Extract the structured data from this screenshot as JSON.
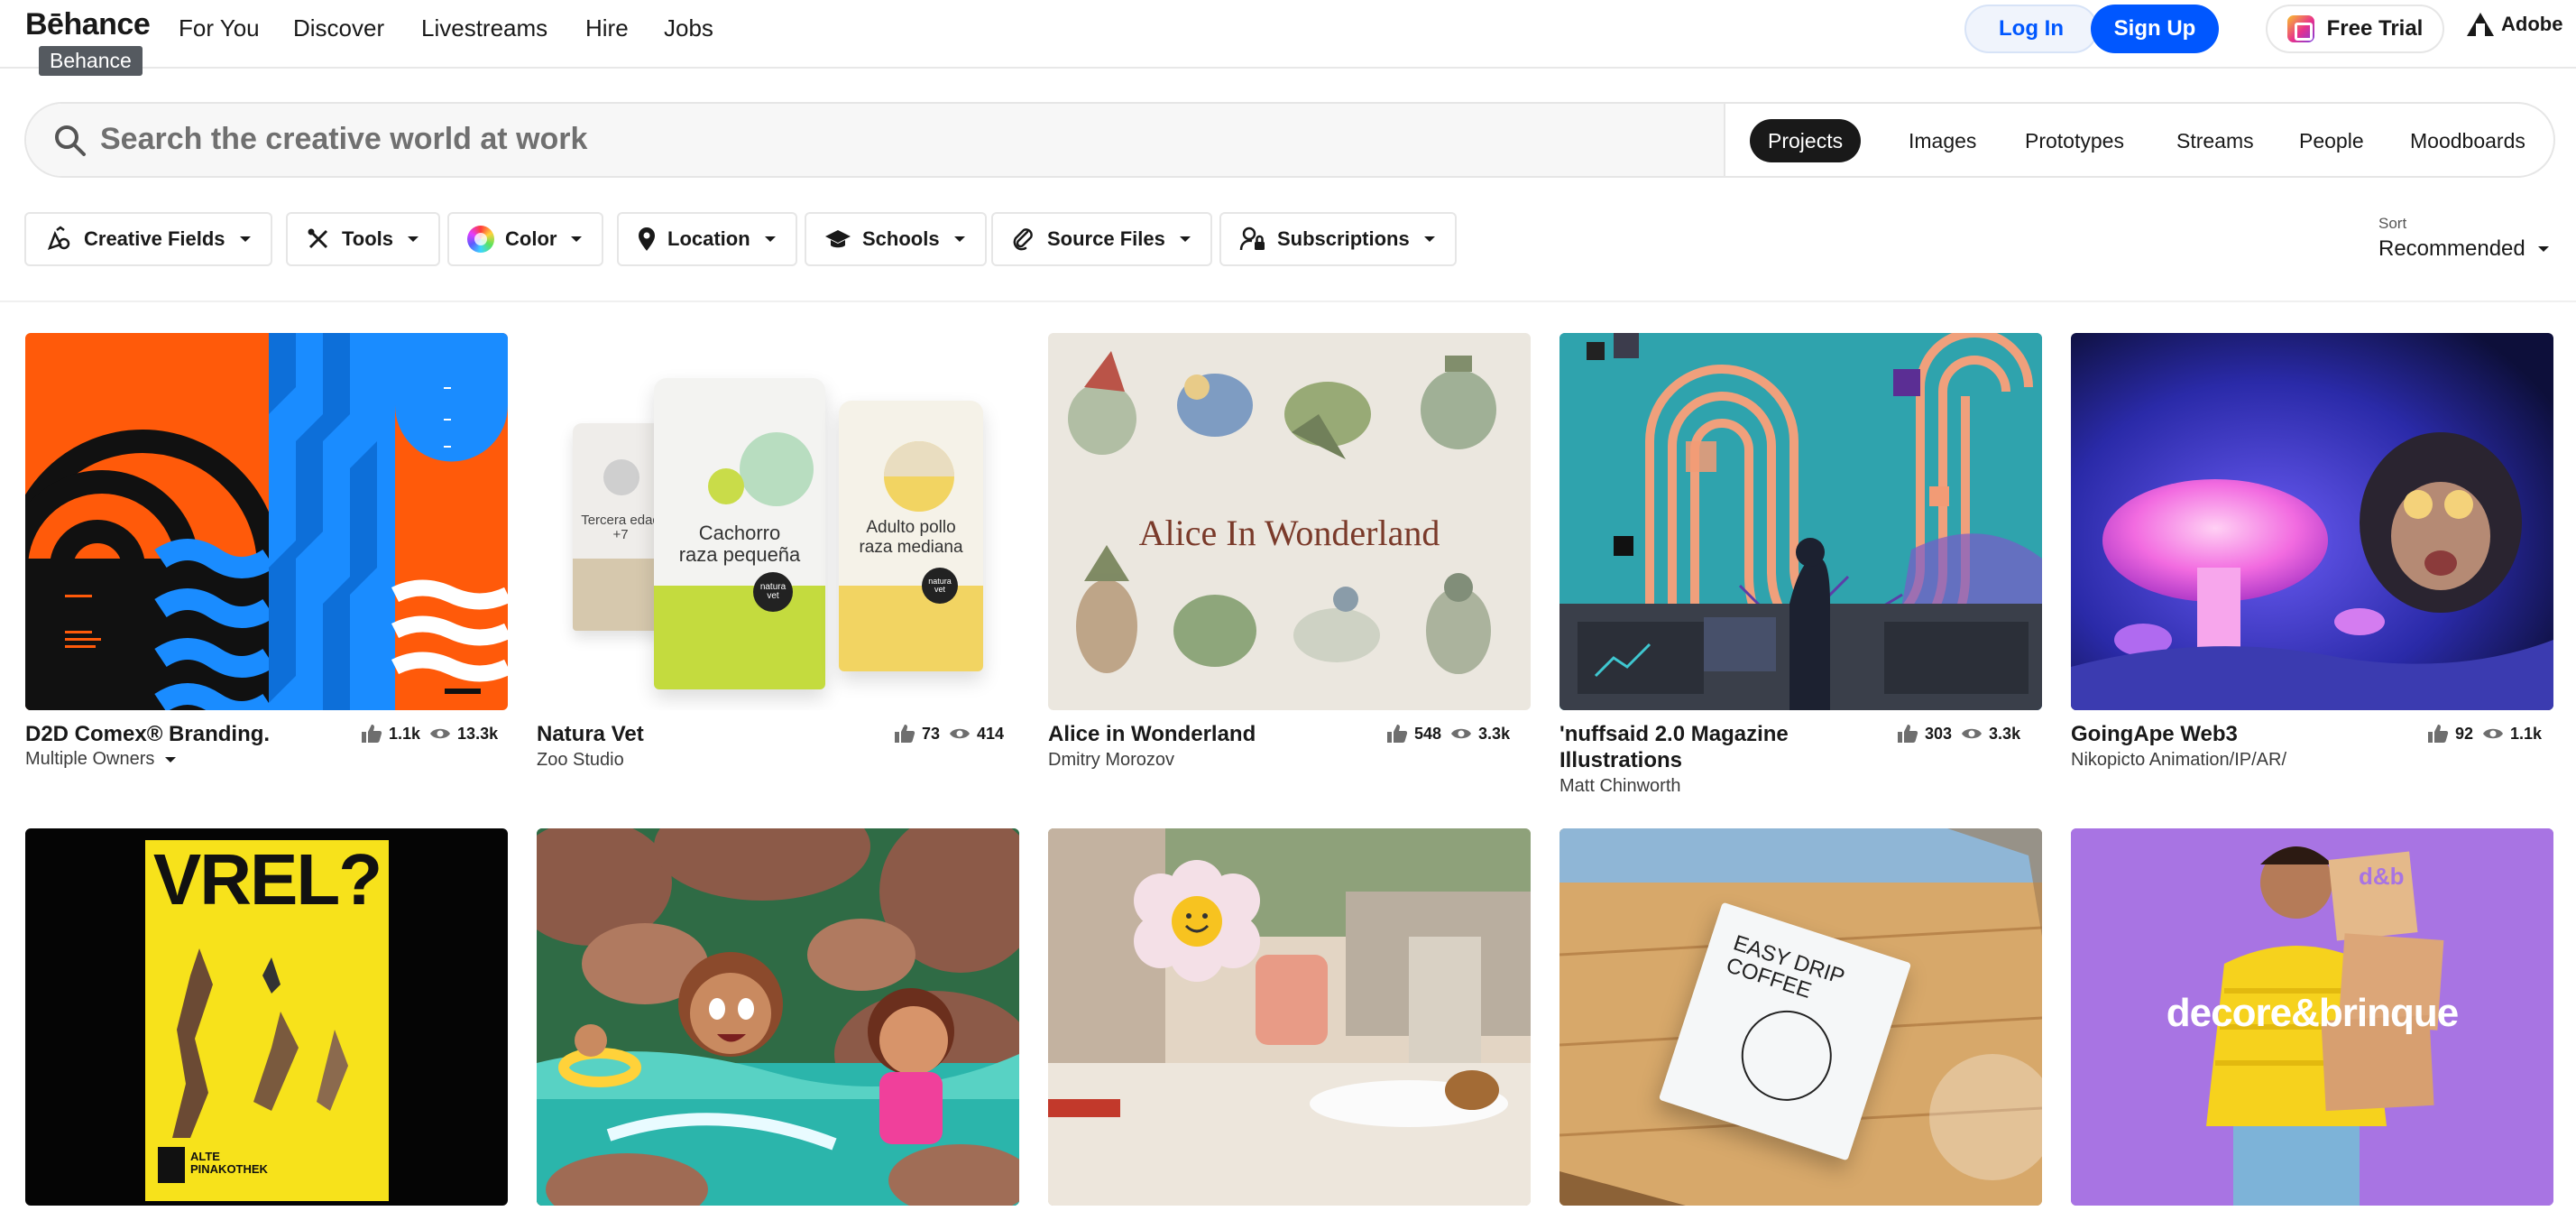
{
  "nav": {
    "logo": "Bēhance",
    "logo_tooltip": "Behance",
    "links": [
      "For You",
      "Discover",
      "Livestreams",
      "Hire",
      "Jobs"
    ],
    "login": "Log In",
    "signup": "Sign Up",
    "free_trial": "Free Trial",
    "adobe": "Adobe"
  },
  "search": {
    "placeholder": "Search the creative world at work",
    "scopes": [
      "Projects",
      "Images",
      "Prototypes",
      "Streams",
      "People",
      "Moodboards"
    ],
    "active_scope": "Projects"
  },
  "filters": {
    "items": [
      {
        "label": "Creative Fields",
        "icon": "creative-fields-icon"
      },
      {
        "label": "Tools",
        "icon": "tools-icon"
      },
      {
        "label": "Color",
        "icon": "color-wheel-icon"
      },
      {
        "label": "Location",
        "icon": "location-pin-icon"
      },
      {
        "label": "Schools",
        "icon": "graduation-cap-icon"
      },
      {
        "label": "Source Files",
        "icon": "paperclip-icon"
      },
      {
        "label": "Subscriptions",
        "icon": "subscriptions-icon"
      }
    ],
    "sort_label": "Sort",
    "sort_value": "Recommended"
  },
  "projects": [
    {
      "title": "D2D Comex® Branding.",
      "owner": "Multiple Owners",
      "owner_dropdown": true,
      "likes": "1.1k",
      "views": "13.3k"
    },
    {
      "title": "Natura Vet",
      "owner": "Zoo Studio",
      "likes": "73",
      "views": "414"
    },
    {
      "title": "Alice in Wonderland",
      "owner": "Dmitry Morozov",
      "likes": "548",
      "views": "3.3k"
    },
    {
      "title": "'nuffsaid 2.0 Magazine Illustrations",
      "owner": "Matt Chinworth",
      "likes": "303",
      "views": "3.3k"
    },
    {
      "title": "GoingApe Web3",
      "owner": "Nikopicto Animation/IP/AR/",
      "likes": "92",
      "views": "1.1k"
    }
  ],
  "thumb_text": {
    "natura_bag1": "Tercera edad +7",
    "natura_bag2_line1": "Cachorro",
    "natura_bag2_line2": "raza pequeña",
    "natura_bag3_line1": "Adulto pollo",
    "natura_bag3_line2": "raza mediana",
    "natura_badge": "natura vet",
    "alice_title": "Alice In Wonderland",
    "vrel_title": "VREL?",
    "vrel_brand": "ALTE PINAKOTHEK",
    "coffee_line1": "EASY DRIP",
    "coffee_line2": "COFFEE",
    "decore": "decore&brinque",
    "decore_box": "d&b"
  }
}
